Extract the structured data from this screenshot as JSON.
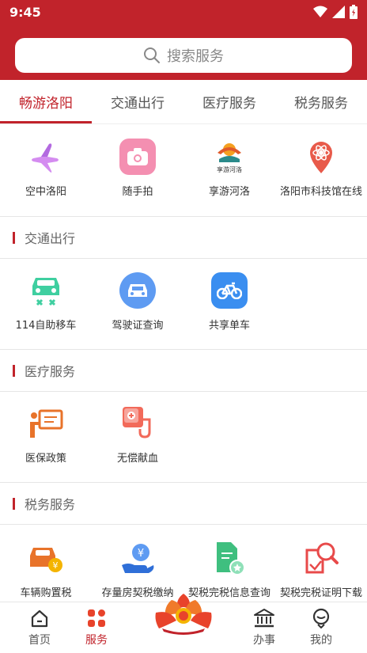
{
  "status": {
    "time": "9:45"
  },
  "search": {
    "placeholder": "搜索服务"
  },
  "tabs": [
    {
      "label": "畅游洛阳"
    },
    {
      "label": "交通出行"
    },
    {
      "label": "医疗服务"
    },
    {
      "label": "税务服务"
    }
  ],
  "tour": {
    "items": [
      {
        "label": "空中洛阳",
        "icon": "airplane-icon"
      },
      {
        "label": "随手拍",
        "icon": "camera-icon"
      },
      {
        "label": "享游河洛",
        "icon": "heluo-logo-icon",
        "logo_text": "享游河洛"
      },
      {
        "label": "洛阳市科技馆在线",
        "icon": "science-museum-pin-icon"
      }
    ]
  },
  "traffic": {
    "title": "交通出行",
    "items": [
      {
        "label": "114自助移车",
        "icon": "car-move-icon"
      },
      {
        "label": "驾驶证查询",
        "icon": "license-car-icon"
      },
      {
        "label": "共享单车",
        "icon": "bicycle-icon"
      }
    ]
  },
  "medical": {
    "title": "医疗服务",
    "items": [
      {
        "label": "医保政策",
        "icon": "presentation-icon"
      },
      {
        "label": "无偿献血",
        "icon": "blood-donation-icon"
      }
    ]
  },
  "tax": {
    "title": "税务服务",
    "items": [
      {
        "label": "车辆购置税",
        "icon": "car-yen-icon"
      },
      {
        "label": "存量房契税缴纳",
        "icon": "hand-yen-icon"
      },
      {
        "label": "契税完税信息查询",
        "icon": "document-star-icon"
      },
      {
        "label": "契税完税证明下载",
        "icon": "search-document-icon"
      }
    ]
  },
  "bottom_nav": [
    {
      "label": "首页",
      "icon": "home-icon"
    },
    {
      "label": "服务",
      "icon": "grid-icon"
    },
    {
      "label": "办事",
      "icon": "government-building-icon"
    },
    {
      "label": "我的",
      "icon": "profile-icon"
    }
  ],
  "colors": {
    "brand_red": "#c1232b",
    "divider": "#e6e6e6"
  }
}
